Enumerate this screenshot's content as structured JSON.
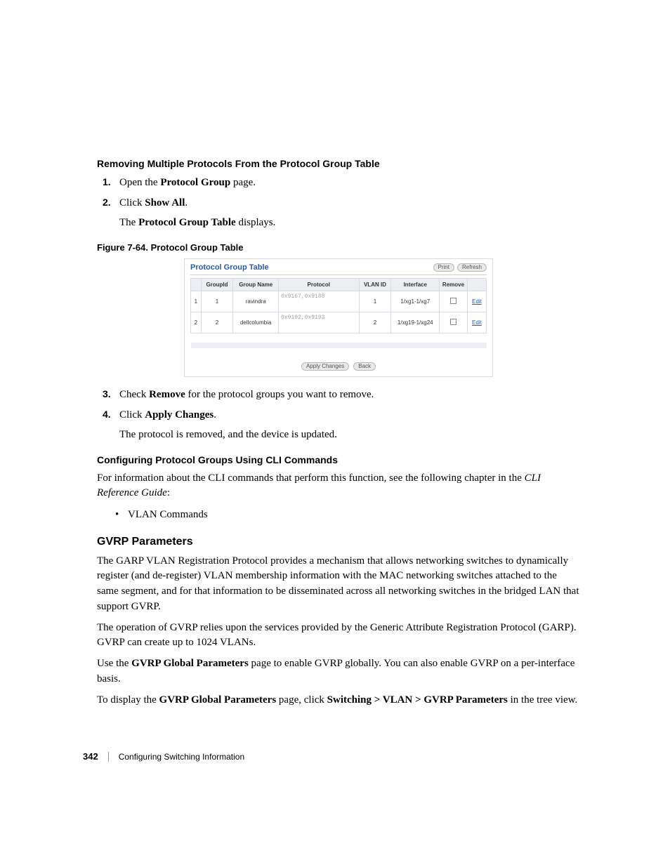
{
  "sections": {
    "remove_heading": "Removing Multiple Protocols From the Protocol Group Table",
    "step1_pre": "Open the ",
    "step1_b": "Protocol Group",
    "step1_post": " page.",
    "step2_pre": "Click ",
    "step2_b": "Show All",
    "step2_post": ".",
    "step2_sub_pre": "The ",
    "step2_sub_b": "Protocol Group Table",
    "step2_sub_post": " displays.",
    "fig_caption": "Figure 7-64.    Protocol Group Table",
    "step3_pre": "Check ",
    "step3_b": "Remove",
    "step3_post": " for the protocol groups you want to remove.",
    "step4_pre": "Click ",
    "step4_b": "Apply Changes",
    "step4_post": ".",
    "step4_sub": "The protocol is removed, and the device is updated.",
    "cli_heading": "Configuring Protocol Groups Using CLI Commands",
    "cli_body_pre": "For information about the CLI commands that perform this function, see the following chapter in the ",
    "cli_body_i": "CLI Reference Guide",
    "cli_body_post": ":",
    "cli_bullet": "VLAN Commands",
    "gvrp_heading": "GVRP Parameters",
    "gvrp_p1": "The GARP VLAN Registration Protocol provides a mechanism that allows networking switches to dynamically register (and de-register) VLAN membership information with the MAC networking switches attached to the same segment, and for that information to be disseminated across all networking switches in the bridged LAN that support GVRP.",
    "gvrp_p2": "The operation of GVRP relies upon the services provided by the Generic Attribute Registration Protocol (GARP). GVRP can create up to 1024 VLANs.",
    "gvrp_p3_pre": "Use the ",
    "gvrp_p3_b": "GVRP Global Parameters",
    "gvrp_p3_post": " page to enable GVRP globally. You can also enable GVRP on a per-interface basis.",
    "gvrp_p4_pre": "To display the ",
    "gvrp_p4_b1": "GVRP Global Parameters",
    "gvrp_p4_mid": " page, click ",
    "gvrp_p4_b2": "Switching > VLAN > GVRP Parameters",
    "gvrp_p4_post": " in the tree view."
  },
  "screenshot": {
    "title": "Protocol Group Table",
    "btn_print": "Print",
    "btn_refresh": "Refresh",
    "btn_apply": "Apply Changes",
    "btn_back": "Back",
    "headers": {
      "row": "",
      "groupid": "GroupId",
      "groupname": "Group Name",
      "protocol": "Protocol",
      "vlanid": "VLAN ID",
      "interface": "Interface",
      "remove": "Remove",
      "edit": ""
    },
    "rows": [
      {
        "idx": "1",
        "groupid": "1",
        "groupname": "ravindra",
        "protocol": "0x9167,0x9188",
        "vlanid": "1",
        "interface": "1/xg1-1/xg7",
        "edit": "Edit"
      },
      {
        "idx": "2",
        "groupid": "2",
        "groupname": "dellcolumbia",
        "protocol": "0x9192,0x9193",
        "vlanid": "2",
        "interface": "1/xg19-1/xg24",
        "edit": "Edit"
      }
    ]
  },
  "footer": {
    "page": "342",
    "section": "Configuring Switching Information"
  }
}
